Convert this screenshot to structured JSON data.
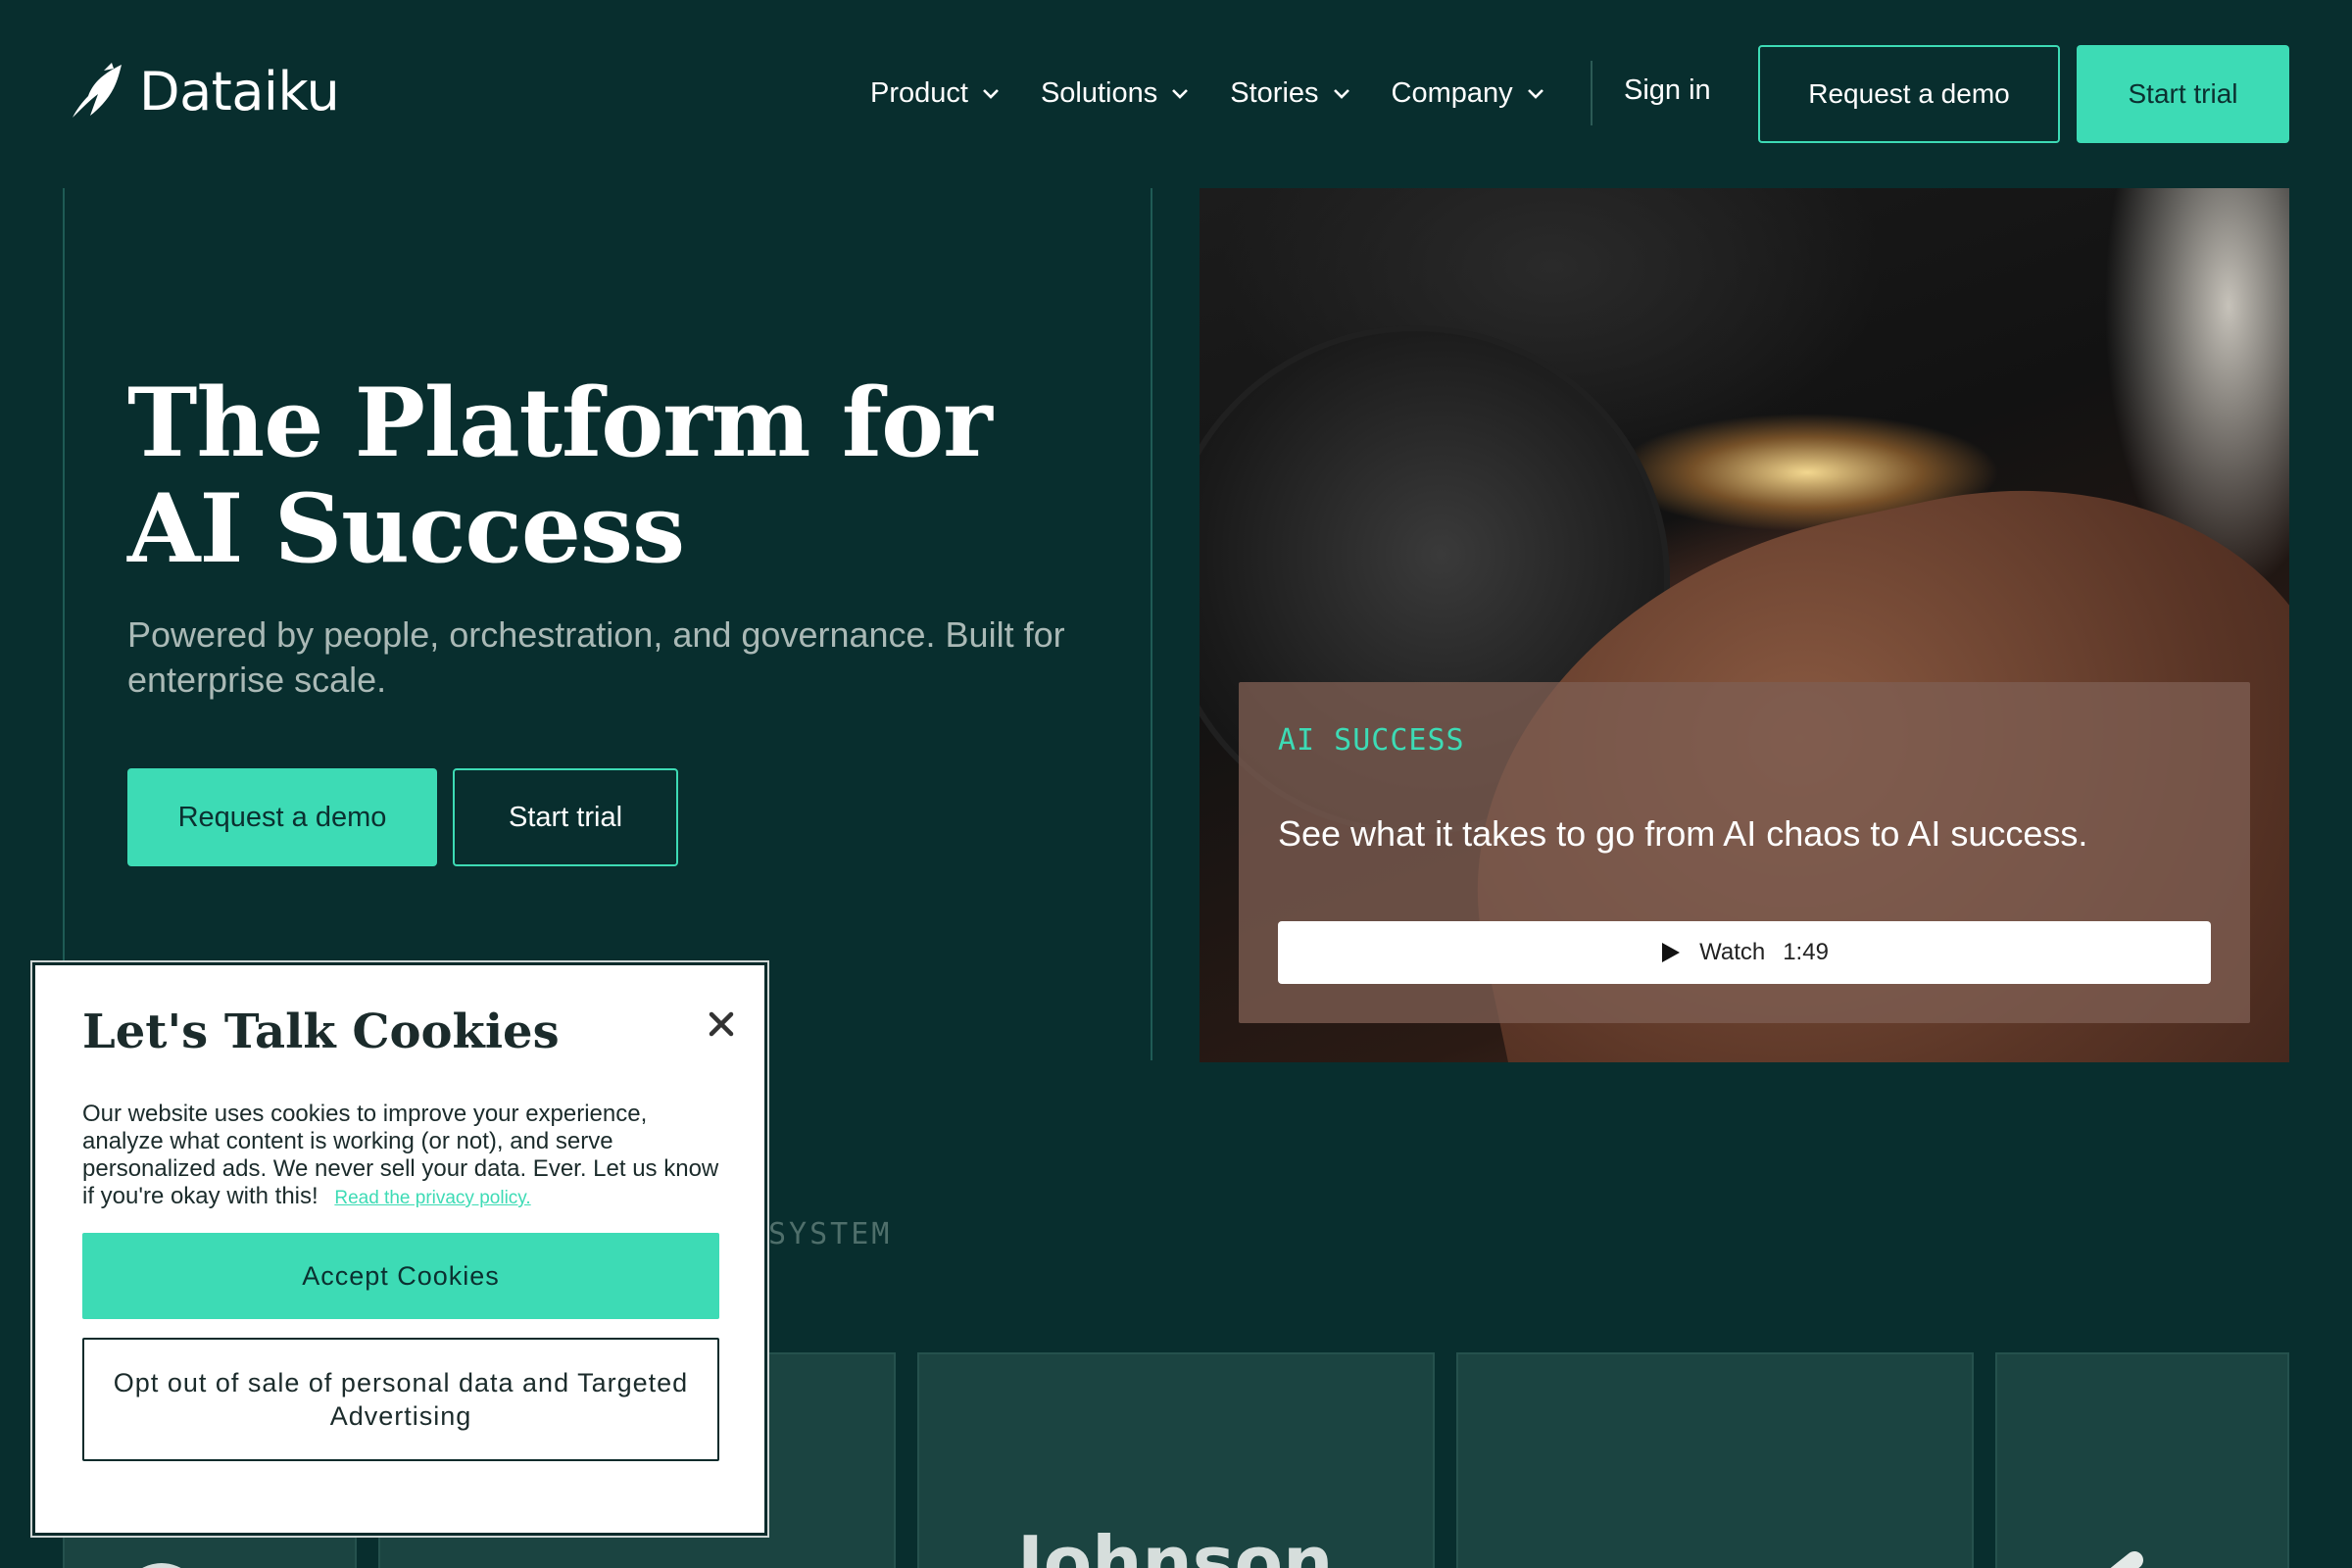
{
  "header": {
    "logo_text": "Dataiku",
    "nav": [
      {
        "label": "Product"
      },
      {
        "label": "Solutions"
      },
      {
        "label": "Stories"
      },
      {
        "label": "Company"
      }
    ],
    "sign_in": "Sign in",
    "request_demo": "Request a demo",
    "start_trial": "Start trial"
  },
  "hero": {
    "title": "The Platform for AI Success",
    "subtitle": "Powered by people, orchestration, and governance. Built for enterprise scale.",
    "request_demo": "Request a demo",
    "start_trial": "Start trial",
    "video": {
      "eyebrow": "AI SUCCESS",
      "title": "See what it takes to go from AI chaos to AI success.",
      "watch_label": "Watch",
      "duration": "1:49"
    }
  },
  "partners": {
    "heading_visible": "SYSTEM",
    "logos": [
      "",
      "",
      "Johnson",
      "",
      ""
    ]
  },
  "cookie": {
    "title": "Let's Talk Cookies",
    "body": "Our website uses cookies to improve your experience, analyze what content is working (or not), and serve personalized ads. We never sell your data. Ever. Let us know if you're okay with this!",
    "privacy_link": "Read the privacy policy.",
    "accept": "Accept Cookies",
    "opt_out": "Opt out of sale of personal data and Targeted Advertising"
  },
  "colors": {
    "background": "#082e2e",
    "accent": "#3ddbb5",
    "text": "#ffffff"
  }
}
